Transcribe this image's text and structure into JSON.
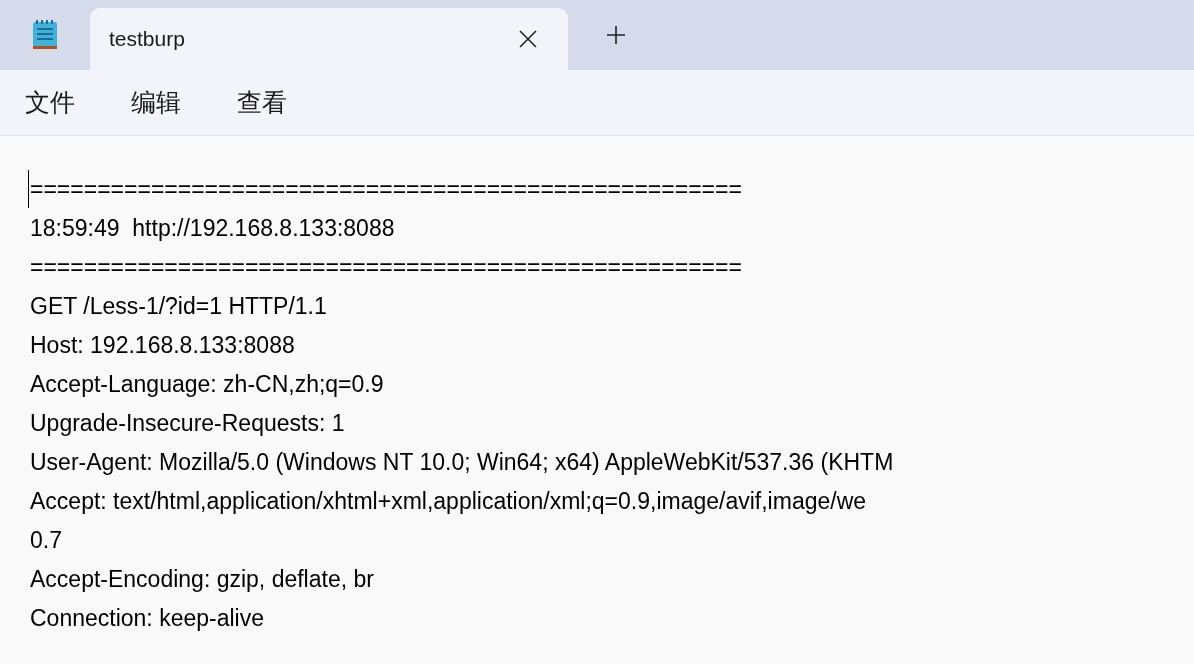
{
  "tabs": [
    {
      "title": "testburp",
      "selected": true
    }
  ],
  "menu": [
    "文件",
    "编辑",
    "查看"
  ],
  "document": {
    "lines": [
      "=====================================================",
      "18:59:49  http://192.168.8.133:8088",
      "=====================================================",
      "GET /Less-1/?id=1 HTTP/1.1",
      "Host: 192.168.8.133:8088",
      "Accept-Language: zh-CN,zh;q=0.9",
      "Upgrade-Insecure-Requests: 1",
      "User-Agent: Mozilla/5.0 (Windows NT 10.0; Win64; x64) AppleWebKit/537.36 (KHTM",
      "Accept: text/html,application/xhtml+xml,application/xml;q=0.9,image/avif,image/we",
      "0.7",
      "Accept-Encoding: gzip, deflate, br",
      "Connection: keep-alive"
    ]
  }
}
